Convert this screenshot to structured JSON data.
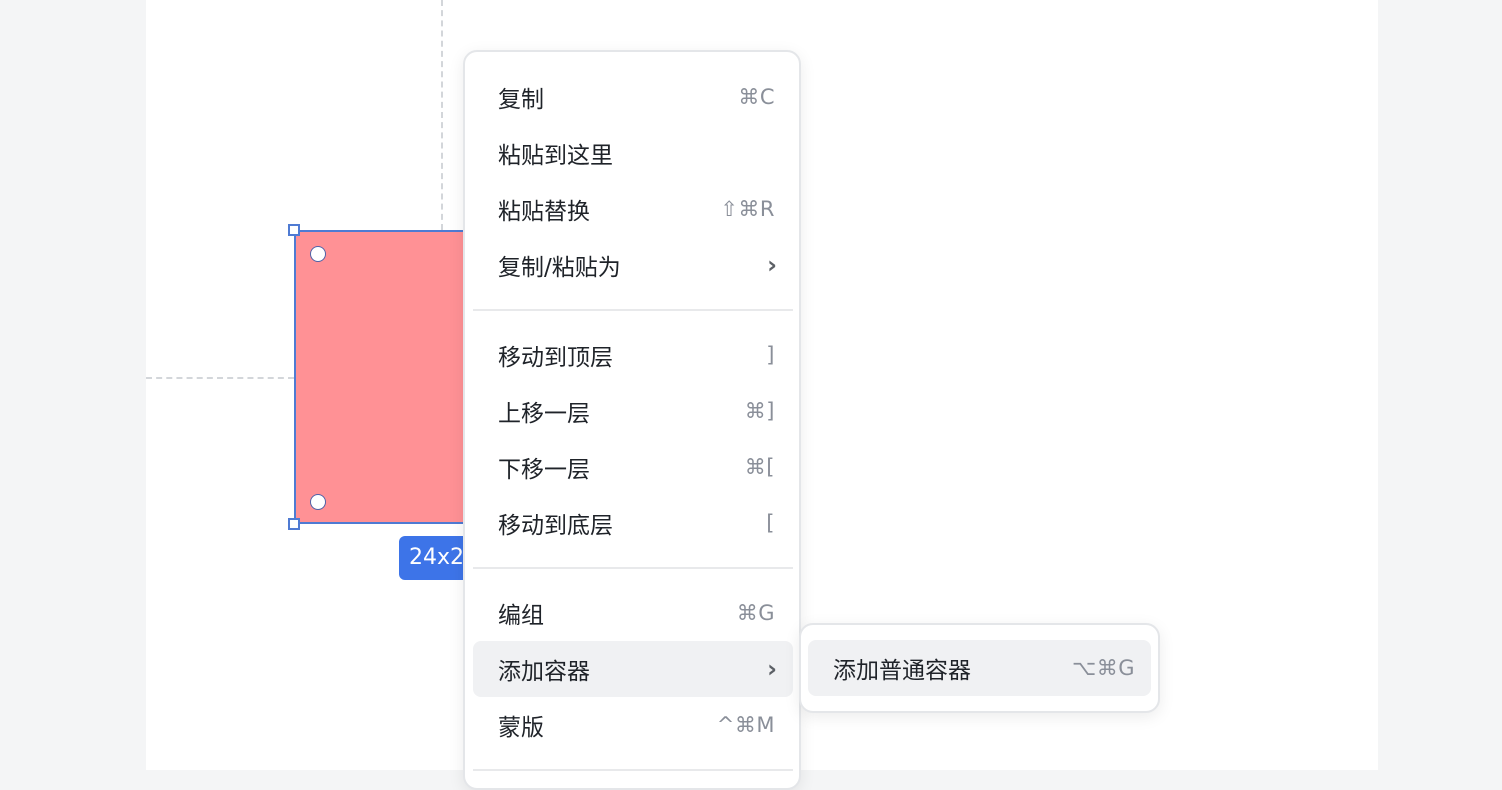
{
  "selection": {
    "size_label": "24x2"
  },
  "colors": {
    "shape_fill": "#ff9195",
    "selection_accent": "#4f7bd3",
    "badge_bg": "#3d74e8"
  },
  "context_menu": {
    "group1": [
      {
        "label": "复制",
        "shortcut": "⌘C"
      },
      {
        "label": "粘贴到这里",
        "shortcut": ""
      },
      {
        "label": "粘贴替换",
        "shortcut": "⇧⌘R"
      },
      {
        "label": "复制/粘贴为",
        "shortcut": "",
        "submenu_icon": "chevron-right-icon"
      }
    ],
    "group2": [
      {
        "label": "移动到顶层",
        "shortcut": "]"
      },
      {
        "label": "上移一层",
        "shortcut": "⌘]"
      },
      {
        "label": "下移一层",
        "shortcut": "⌘["
      },
      {
        "label": "移动到底层",
        "shortcut": "["
      }
    ],
    "group3": [
      {
        "label": "编组",
        "shortcut": "⌘G"
      },
      {
        "label": "添加容器",
        "shortcut": "",
        "submenu_icon": "chevron-right-icon",
        "highlighted": true
      },
      {
        "label": "蒙版",
        "shortcut": "^⌘M"
      }
    ]
  },
  "submenu": {
    "items": [
      {
        "label": "添加普通容器",
        "shortcut": "⌥⌘G"
      }
    ]
  }
}
